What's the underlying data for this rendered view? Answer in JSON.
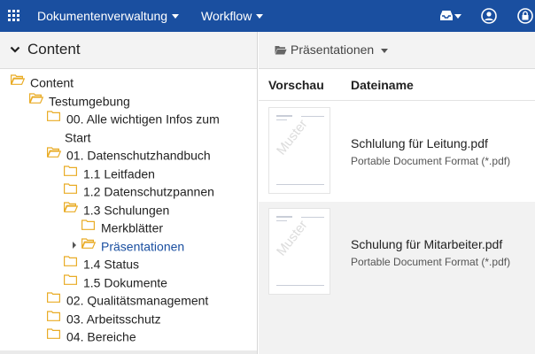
{
  "topbar": {
    "menus": [
      {
        "label": "Dokumentenverwaltung"
      },
      {
        "label": "Workflow"
      }
    ],
    "icons": [
      "apps-grid-icon",
      "inbox-icon",
      "user-icon",
      "lock-icon"
    ],
    "color": "#1a4fa0"
  },
  "left": {
    "title": "Content",
    "tree": [
      {
        "label": "Content",
        "level": 0,
        "open": true
      },
      {
        "label": "Testumgebung",
        "level": 1,
        "open": true
      },
      {
        "label": "00. Alle wichtigen Infos zum",
        "label2": "Start",
        "level": 2,
        "open": false
      },
      {
        "label": "01. Datenschutzhandbuch",
        "level": 2,
        "open": true
      },
      {
        "label": "1.1 Leitfaden",
        "level": 3,
        "open": false
      },
      {
        "label": "1.2 Datenschutzpannen",
        "level": 3,
        "open": false
      },
      {
        "label": "1.3 Schulungen",
        "level": 3,
        "open": true
      },
      {
        "label": "Merkblätter",
        "level": 4,
        "open": false
      },
      {
        "label": "Präsentationen",
        "level": 4,
        "open": true,
        "selected": true
      },
      {
        "label": "1.4 Status",
        "level": 3,
        "open": false
      },
      {
        "label": "1.5 Dokumente",
        "level": 3,
        "open": false
      },
      {
        "label": "02. Qualitätsmanagement",
        "level": 2,
        "open": false
      },
      {
        "label": "03. Arbeitsschutz",
        "level": 2,
        "open": false
      },
      {
        "label": "04. Bereiche",
        "level": 2,
        "open": false
      }
    ]
  },
  "right": {
    "folder_label": "Präsentationen",
    "columns": {
      "preview": "Vorschau",
      "filename": "Dateiname"
    },
    "files": [
      {
        "name": "Schlulung für Leitung.pdf",
        "type": "Portable Document Format (*.pdf)",
        "watermark": "Muster"
      },
      {
        "name": "Schulung für Mitarbeiter.pdf",
        "type": "Portable Document Format (*.pdf)",
        "watermark": "Muster"
      }
    ]
  }
}
